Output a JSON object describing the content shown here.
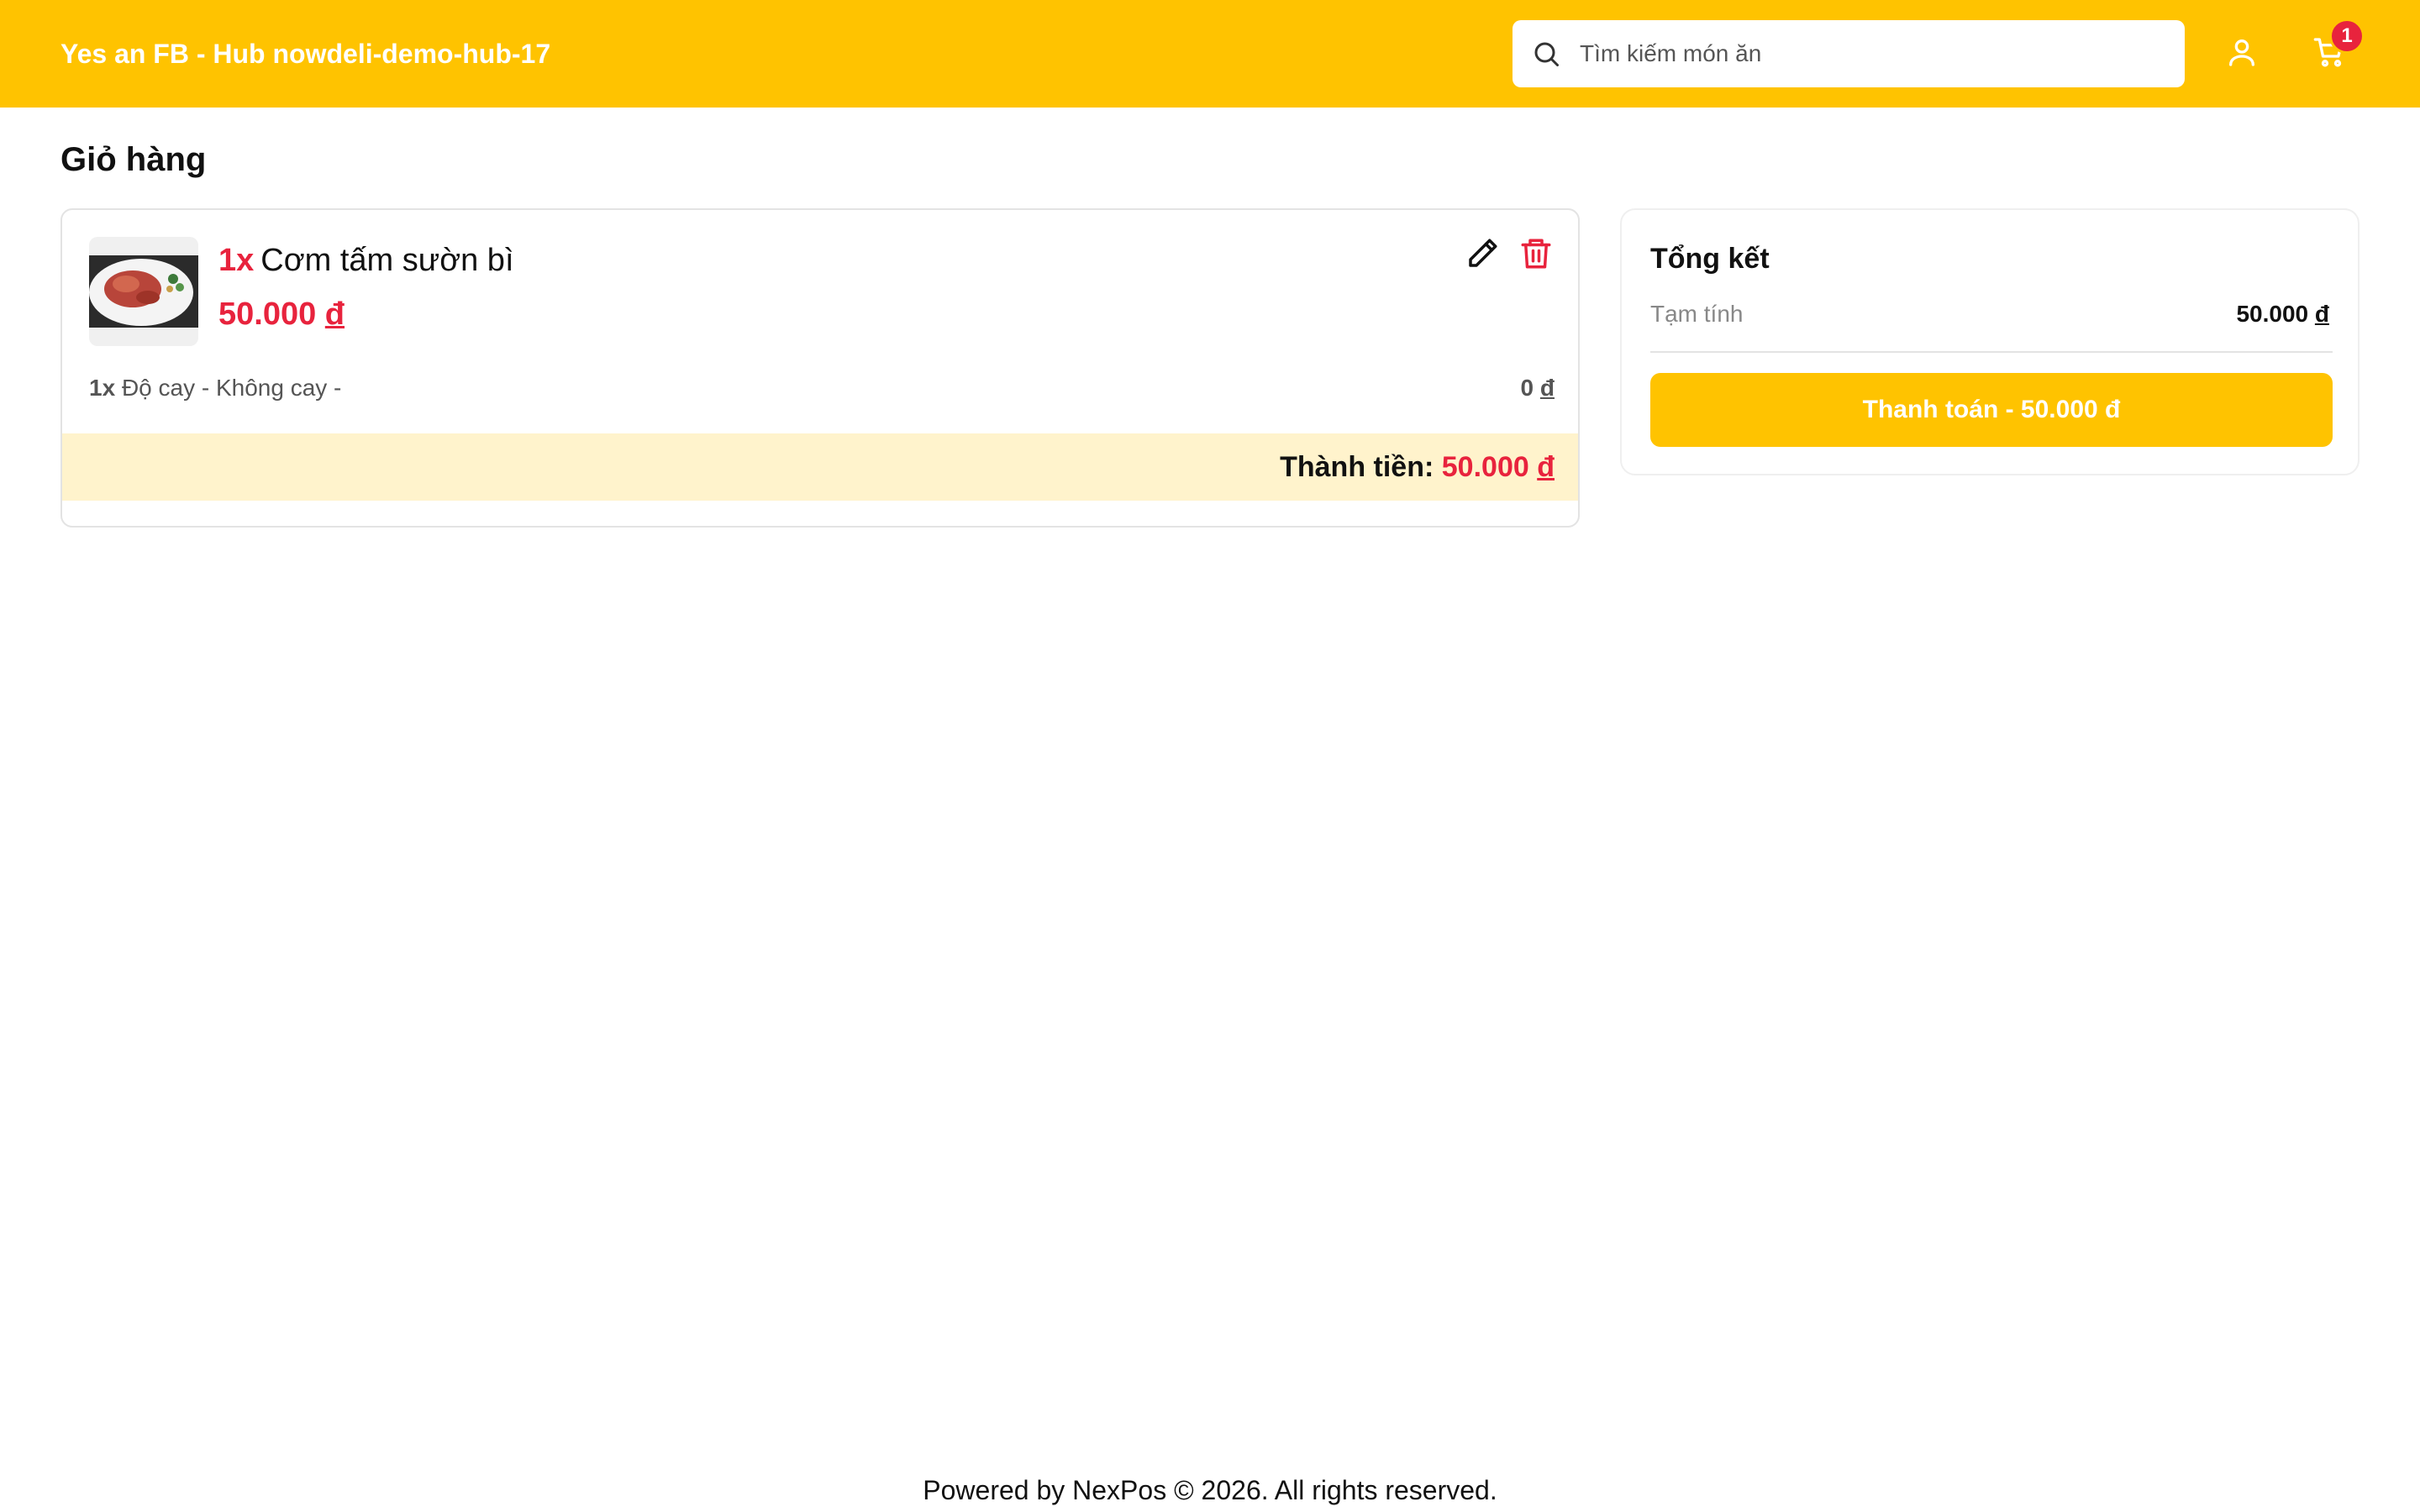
{
  "header": {
    "brand": "Yes an FB - Hub nowdeli-demo-hub-17",
    "search_placeholder": "Tìm kiếm món ăn",
    "cart_count": "1",
    "brand_color": "#ffc300"
  },
  "page": {
    "title": "Giỏ hàng"
  },
  "cart": {
    "items": [
      {
        "qty": "1x",
        "name": "Cơm tấm sườn bì",
        "price_amount": "50.000",
        "currency": "đ",
        "option_qty": "1x",
        "option_text": "Độ cay - Không cay -",
        "option_price_amount": "0",
        "total_label": "Thành tiền:",
        "total_amount": "50.000"
      }
    ]
  },
  "summary": {
    "title": "Tổng kết",
    "subtotal_label": "Tạm tính",
    "subtotal_amount": "50.000",
    "currency": "đ",
    "pay_button": "Thanh toán - 50.000 đ"
  },
  "footer": {
    "text": "Powered by NexPos © 2026. All rights reserved."
  },
  "icons": {
    "search": "search-icon",
    "user": "user-icon",
    "cart": "cart-icon",
    "edit": "pencil-icon",
    "delete": "trash-icon"
  }
}
